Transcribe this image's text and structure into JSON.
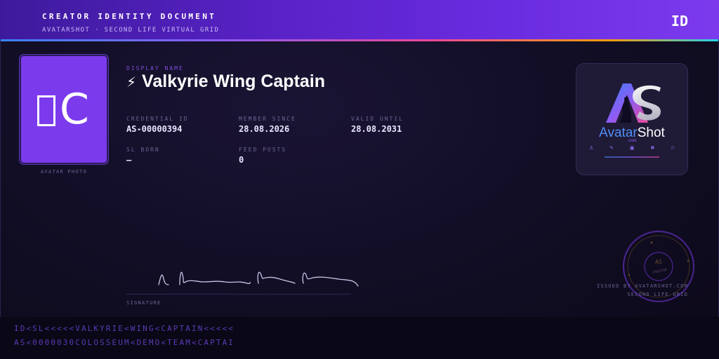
{
  "header": {
    "title": "CREATOR IDENTITY DOCUMENT",
    "subtitle": "AVATARSHOT · SECOND LIFE VIRTUAL GRID",
    "badge": "ID"
  },
  "photo": {
    "initials": "C",
    "caption": "AVATAR PHOTO"
  },
  "identity": {
    "display_name_label": "DISPLAY NAME",
    "display_name_icon": "lightning-bolt-icon",
    "display_name": "Valkyrie Wing Captain"
  },
  "fields": {
    "credential_id": {
      "label": "CREDENTIAL ID",
      "value": "AS-00000394"
    },
    "member_since": {
      "label": "MEMBER SINCE",
      "value": "28.08.2026"
    },
    "valid_until": {
      "label": "VALID UNTIL",
      "value": "28.08.2031"
    },
    "sl_born": {
      "label": "SL BORN",
      "value": "—"
    },
    "feed_posts": {
      "label": "FEED POSTS",
      "value": "0"
    }
  },
  "logo": {
    "wordmark_a": "Avatar",
    "wordmark_b": "Shot",
    "domain": ".com"
  },
  "signature": {
    "label": "SIGNATURE"
  },
  "seal": {
    "center": "AS",
    "sub": "CREATOR",
    "issued_line1": "ISSUED BY AVATARSHOT.COM",
    "issued_line2": "SECOND LIFE GRID"
  },
  "mrz": {
    "line1": "ID<SL<<<<<VALKYRIE<WING<CAPTAIN<<<<<",
    "line2": "AS<0000030COLOSSEUM<DEMO<TEAM<CAPTAI"
  },
  "colors": {
    "accent": "#7c3aed",
    "header_start": "#3d1a9c",
    "header_end": "#7c3aed",
    "background": "#120e26",
    "mrz_text": "#5a3bb5"
  }
}
